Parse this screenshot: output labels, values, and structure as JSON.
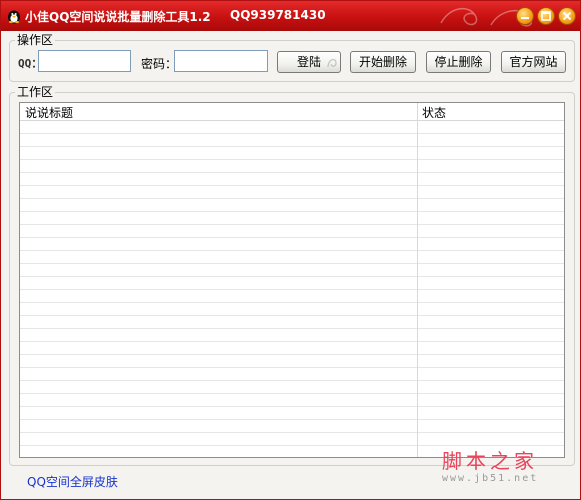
{
  "window": {
    "title": "小佳QQ空间说说批量删除工具1.2",
    "contact": "QQ939781430",
    "minimize_icon": "minimize-icon",
    "maximize_icon": "maximize-icon",
    "close_icon": "close-icon",
    "theme_color": "#c71010"
  },
  "operation": {
    "group_label": "操作区",
    "qq_label": "QQ：",
    "qq_value": "",
    "password_label": "密码：",
    "password_value": "",
    "login_button": "登陆",
    "start_delete_button": "开始删除",
    "stop_delete_button": "停止删除",
    "website_button": "官方网站"
  },
  "work": {
    "group_label": "工作区",
    "columns": [
      "说说标题",
      "状态"
    ],
    "rows": []
  },
  "footer": {
    "skin_link": "QQ空间全屏皮肤",
    "link_color": "#1a33cc"
  },
  "watermark": {
    "text": "脚本之家",
    "url": "www.jb51.net"
  }
}
